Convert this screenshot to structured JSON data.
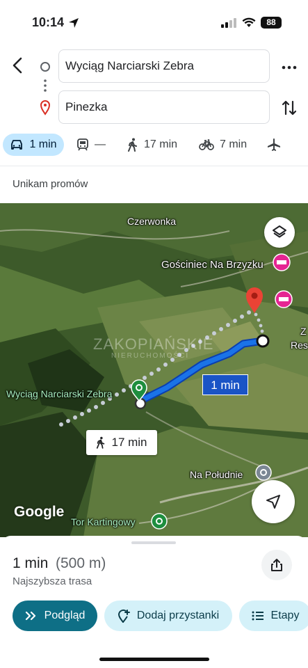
{
  "status": {
    "time": "10:14",
    "battery": "88"
  },
  "route": {
    "origin": "Wyciąg Narciarski Zebra",
    "destination": "Pinezka"
  },
  "modes": [
    {
      "icon": "car-icon",
      "label": "1 min",
      "active": true
    },
    {
      "icon": "transit-icon",
      "label": "—"
    },
    {
      "icon": "walk-icon",
      "label": "17 min"
    },
    {
      "icon": "bike-icon",
      "label": "7 min"
    },
    {
      "icon": "flight-icon",
      "label": ""
    }
  ],
  "options_text": "Unikam promów",
  "map": {
    "labels": {
      "czerwonka": "Czerwonka",
      "gosciniec": "Gościniec Na Brzyzku",
      "origin": "Wyciąg Narciarski Zebra",
      "na_poludnie": "Na Południe",
      "tor": "Tor Kartingowy",
      "edge_z": "Z",
      "edge_res": "Res"
    },
    "watermark": "ZAKOPIAŃSKIE",
    "watermark_sub": "NIERUCHOMOŚCI",
    "drive_time": "1 min",
    "walk_time": "17 min",
    "google_logo": "Google",
    "colors": {
      "route": "#1a54c6",
      "pin": "#ea4335",
      "green_poi": "#1e8e3e",
      "hotel_poi": "#e52592"
    }
  },
  "summary": {
    "duration": "1 min",
    "distance": "(500 m)",
    "subtitle": "Najszybsza trasa",
    "buttons": {
      "preview": "Podgląd",
      "add_stops": "Dodaj przystanki",
      "steps": "Etapy"
    }
  }
}
